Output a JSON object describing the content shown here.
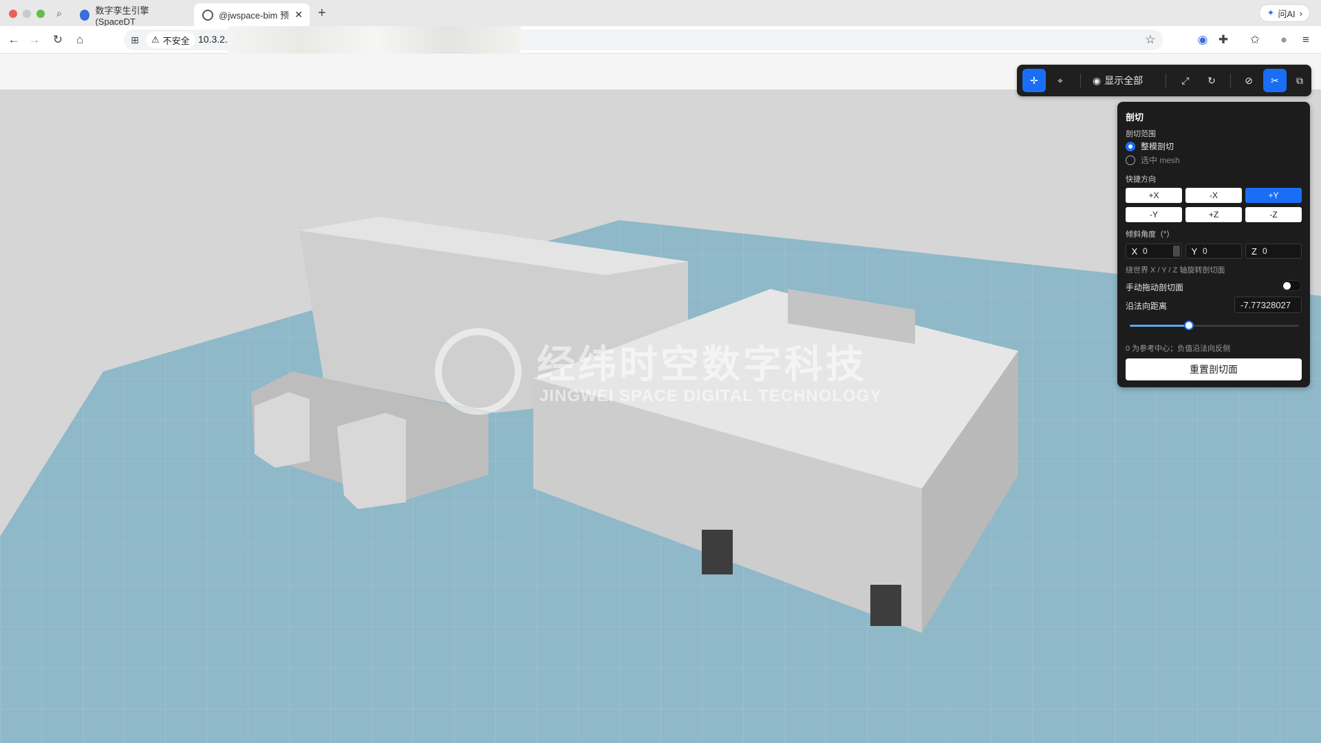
{
  "browser": {
    "tabs": [
      {
        "label": "数字孪生引擎(SpaceDT"
      },
      {
        "label": "@jwspace-bim 预"
      }
    ],
    "new_tab": "+",
    "ai_button": "问AI",
    "insecure_label": "不安全",
    "url": "10.3.2."
  },
  "viewer_toolbar": {
    "show_all_label": "显示全部"
  },
  "watermark": {
    "cn": "经纬时空数字科技",
    "en": "JINGWEI SPACE DIGITAL TECHNOLOGY"
  },
  "section_panel": {
    "title": "剖切",
    "range_label": "剖切范围",
    "range_options": [
      {
        "label": "整模剖切",
        "selected": true
      },
      {
        "label": "选中 mesh",
        "selected": false
      }
    ],
    "quick_dir_label": "快捷方向",
    "directions": [
      {
        "label": "+X",
        "active": false
      },
      {
        "label": "-X",
        "active": false
      },
      {
        "label": "+Y",
        "active": true
      },
      {
        "label": "-Y",
        "active": false
      },
      {
        "label": "+Z",
        "active": false
      },
      {
        "label": "-Z",
        "active": false
      }
    ],
    "tilt_label": "倾斜角度（°）",
    "tilt": [
      {
        "axis": "X",
        "value": "0"
      },
      {
        "axis": "Y",
        "value": "0"
      },
      {
        "axis": "Z",
        "value": "0"
      }
    ],
    "tilt_hint": "绕世界 X / Y / Z 轴旋转剖切面",
    "manual_drag_label": "手动拖动剖切面",
    "manual_drag_on": false,
    "distance_label": "沿法向距离",
    "distance_value": "-7.77328027",
    "distance_slider_fraction": 0.35,
    "distance_hint": "0 为参考中心；负值沿法向反侧",
    "reset_label": "重置剖切面"
  },
  "colors": {
    "accent": "#1a6ef5",
    "panel_bg": "#1c1c1c",
    "ground": "#8fb8c8"
  }
}
